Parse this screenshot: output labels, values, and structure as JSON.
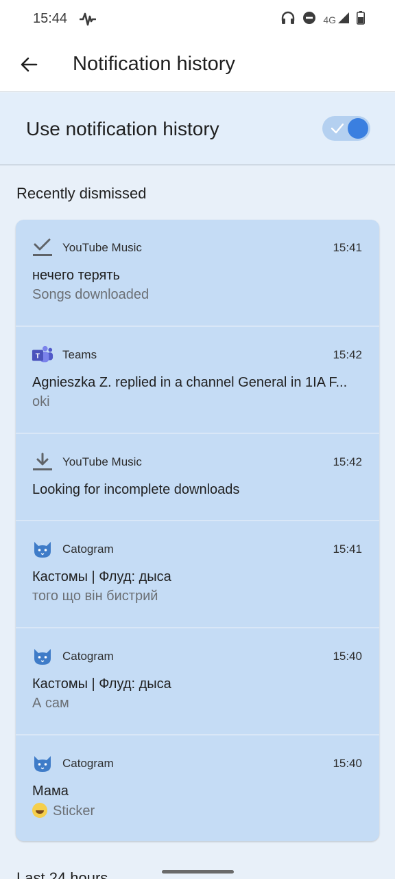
{
  "status_bar": {
    "time": "15:44",
    "network": "4G",
    "icons": [
      "waveform-icon",
      "headphones-icon",
      "do-not-disturb-icon",
      "signal-icon",
      "battery-icon"
    ]
  },
  "app_bar": {
    "title": "Notification history",
    "back_icon": "arrow-back-icon"
  },
  "toggle": {
    "label": "Use notification history",
    "enabled": true,
    "accent": "#3a7fe0"
  },
  "recently_dismissed": {
    "title": "Recently dismissed",
    "items": [
      {
        "app": "YouTube Music",
        "icon": "download-done-icon",
        "time": "15:41",
        "title": "нечего терять",
        "text": "Songs downloaded"
      },
      {
        "app": "Teams",
        "icon": "teams-icon",
        "time": "15:42",
        "title": "Agnieszka Z. replied in a channel General in 1IA F...",
        "text": "oki"
      },
      {
        "app": "YouTube Music",
        "icon": "download-icon",
        "time": "15:42",
        "title": "Looking for incomplete downloads",
        "text": ""
      },
      {
        "app": "Catogram",
        "icon": "cat-icon",
        "time": "15:41",
        "title": "Кастомы | Флуд: дыса",
        "text": "того що він бистрий"
      },
      {
        "app": "Catogram",
        "icon": "cat-icon",
        "time": "15:40",
        "title": "Кастомы | Флуд: дыса",
        "text": "А сам"
      },
      {
        "app": "Catogram",
        "icon": "cat-icon",
        "time": "15:40",
        "title": "Мама",
        "text": "Sticker"
      }
    ]
  },
  "last_24_hours": {
    "title": "Last 24 hours"
  }
}
